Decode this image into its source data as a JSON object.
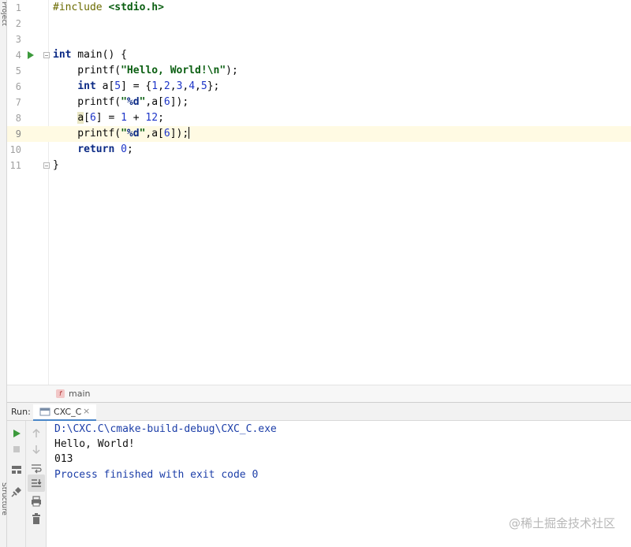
{
  "side_strip": {
    "top_label": "Project",
    "bottom_label": "Structure"
  },
  "editor": {
    "lines": [
      {
        "no": "1",
        "html": "<span class=\"pp\">#include </span><span class=\"str\">&lt;stdio.h&gt;</span>"
      },
      {
        "no": "2",
        "html": ""
      },
      {
        "no": "3",
        "html": ""
      },
      {
        "no": "4",
        "html": "<span class=\"kw\">int</span> main() {"
      },
      {
        "no": "5",
        "html": "    printf(<span class=\"str\">\"Hello, World!\\n\"</span>);"
      },
      {
        "no": "6",
        "html": "    <span class=\"kw\">int</span> a[<span class=\"num\">5</span>] = {<span class=\"num\">1</span>,<span class=\"num\">2</span>,<span class=\"num\">3</span>,<span class=\"num\">4</span>,<span class=\"num\">5</span>};"
      },
      {
        "no": "7",
        "html": "    printf(<span class=\"str\">\"</span><span class=\"fmt\">%d</span><span class=\"str\">\"</span>,a[<span class=\"num\">6</span>]);"
      },
      {
        "no": "8",
        "html": "    <span class=\"brace-hl\">a</span>[<span class=\"num\">6</span>] = <span class=\"num\">1</span> + <span class=\"num\">12</span>;"
      },
      {
        "no": "9",
        "html": "    printf(<span class=\"str\">\"</span><span class=\"fmt\">%d</span><span class=\"str\">\"</span>,a[<span class=\"num\">6</span>]);<span class=\"cursor\"></span>"
      },
      {
        "no": "10",
        "html": "    <span class=\"kw\">return</span> <span class=\"num\">0</span>;"
      },
      {
        "no": "11",
        "html": "}"
      }
    ],
    "current_line": "9"
  },
  "breadcrumb": {
    "badge": "f",
    "label": "main"
  },
  "run": {
    "title": "Run:",
    "tab_label": "CXC_C",
    "close_glyph": "×",
    "output": [
      {
        "text": "D:\\CXC.C\\cmake-build-debug\\CXC_C.exe",
        "style": "blue"
      },
      {
        "text": "Hello, World!",
        "style": "black"
      },
      {
        "text": "013",
        "style": "black"
      },
      {
        "text": "Process finished with exit code 0",
        "style": "blue"
      }
    ],
    "toolbar_icons": [
      "run-icon",
      "stop-icon",
      "layout-icon",
      "pin-icon",
      "up-arrow-icon",
      "down-arrow-icon",
      "soft-wrap-icon",
      "scroll-to-end-icon",
      "print-icon",
      "trash-icon"
    ]
  },
  "watermark": "@稀土掘金技术社区",
  "colors": {
    "accent": "#4a86c8",
    "current_line": "#fffae3",
    "run_green": "#3c9a3c"
  }
}
